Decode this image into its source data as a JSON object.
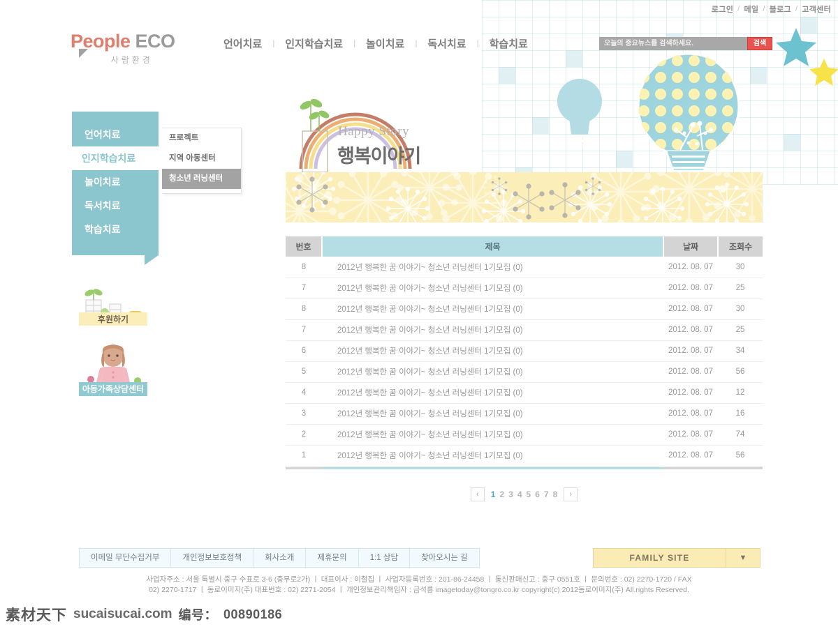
{
  "topbar": {
    "links": [
      "로그인",
      "메일",
      "블로그",
      "고객센터"
    ],
    "separator": "/"
  },
  "logo": {
    "people": "People",
    "eco": " ECO",
    "sub": "사람환경"
  },
  "gnb": {
    "items": [
      "언어치료",
      "인지학습치료",
      "놀이치료",
      "독서치료",
      "학습치료"
    ],
    "divider": "ㅣ"
  },
  "search": {
    "placeholder": "오늘의 중요뉴스를 검색하세요.",
    "value": "",
    "button_label": "검색"
  },
  "sidebar": {
    "items": [
      {
        "label": "언어치료",
        "active": false
      },
      {
        "label": "인지학습치료",
        "active": true
      },
      {
        "label": "놀이치료",
        "active": false
      },
      {
        "label": "독서치료",
        "active": false
      },
      {
        "label": "학습치료",
        "active": false
      }
    ],
    "submenu": [
      {
        "label": "프로젝트",
        "active": false
      },
      {
        "label": "지역 아동센터",
        "active": false
      },
      {
        "label": "청소년 러닝센터",
        "active": true
      }
    ]
  },
  "banners": [
    {
      "label": "후원하기",
      "name": "donate-banner"
    },
    {
      "label": "아동가족상담센터",
      "name": "child-family-counseling-banner"
    }
  ],
  "page_head": {
    "english": "Happy Story",
    "korean": "행복이야기"
  },
  "board": {
    "headers": [
      "번호",
      "제목",
      "날짜",
      "조회수"
    ],
    "rows": [
      {
        "no": "8",
        "title": "2012년 행복한 꿈 이야기~ 청소년 러닝센터 1기모집 (0)",
        "date": "2012. 08. 07",
        "hits": "30"
      },
      {
        "no": "7",
        "title": "2012년 행복한 꿈 이야기~ 청소년 러닝센터 1기모집 (0)",
        "date": "2012. 08. 07",
        "hits": "25"
      },
      {
        "no": "8",
        "title": "2012년 행복한 꿈 이야기~ 청소년 러닝센터 1기모집 (0)",
        "date": "2012. 08. 07",
        "hits": "30"
      },
      {
        "no": "7",
        "title": "2012년 행복한 꿈 이야기~ 청소년 러닝센터 1기모집 (0)",
        "date": "2012. 08. 07",
        "hits": "25"
      },
      {
        "no": "6",
        "title": "2012년 행복한 꿈 이야기~ 청소년 러닝센터 1기모집 (0)",
        "date": "2012. 08. 07",
        "hits": "34"
      },
      {
        "no": "5",
        "title": "2012년 행복한 꿈 이야기~ 청소년 러닝센터 1기모집 (0)",
        "date": "2012. 08. 07",
        "hits": "56"
      },
      {
        "no": "4",
        "title": "2012년 행복한 꿈 이야기~ 청소년 러닝센터 1기모집 (0)",
        "date": "2012. 08. 07",
        "hits": "12"
      },
      {
        "no": "3",
        "title": "2012년 행복한 꿈 이야기~ 청소년 러닝센터 1기모집 (0)",
        "date": "2012. 08. 07",
        "hits": "16"
      },
      {
        "no": "2",
        "title": "2012년 행복한 꿈 이야기~ 청소년 러닝센터 1기모집 (0)",
        "date": "2012. 08. 07",
        "hits": "74"
      },
      {
        "no": "1",
        "title": "2012년 행복한 꿈 이야기~ 청소년 러닝센터 1기모집 (0)",
        "date": "2012. 08. 07",
        "hits": "56"
      }
    ]
  },
  "paging": {
    "prev": "‹",
    "next": "›",
    "pages": [
      "1",
      "2",
      "3",
      "4",
      "5",
      "6",
      "7",
      "8"
    ],
    "current": "1"
  },
  "footer": {
    "links": [
      "이메일 무단수집거부",
      "개인정보보호정책",
      "회사소개",
      "제휴문의",
      "1:1 상담",
      "찾아오시는 길"
    ],
    "family_site": "FAMILY SITE",
    "family_arrow": "▼",
    "copyright_line1": "사업자주소 : 서울 특별시 중구 수표로 3-6 (충무로2가)  ㅣ  대표이사 : 이철집  ㅣ  사업자등록번호 : 201-86-24458  ㅣ  통신판매신고 : 중구 0551호   ㅣ   문의번호 : 02) 2270-1720 / FAX",
    "copyright_line2": "02) 2270-1717  ㅣ  동로이미지(주) 대표번호 : 02) 2271-2054  ㅣ  개인정보관리책임자 : 금석룡 imagetoday@tongro.co.kr   copyright(c) 2012동로이미지(주) All.rights Reserved."
  },
  "watermark": {
    "cn": "素材天下",
    "url": "sucaisucai.com",
    "label": "编号：",
    "number": "00890186"
  },
  "colors": {
    "brand_red": "#e07e6e",
    "teal": "#8bc5cd",
    "header_teal": "#b4dde4",
    "yellow": "#fbeeb8",
    "search_red": "#e8524f"
  }
}
